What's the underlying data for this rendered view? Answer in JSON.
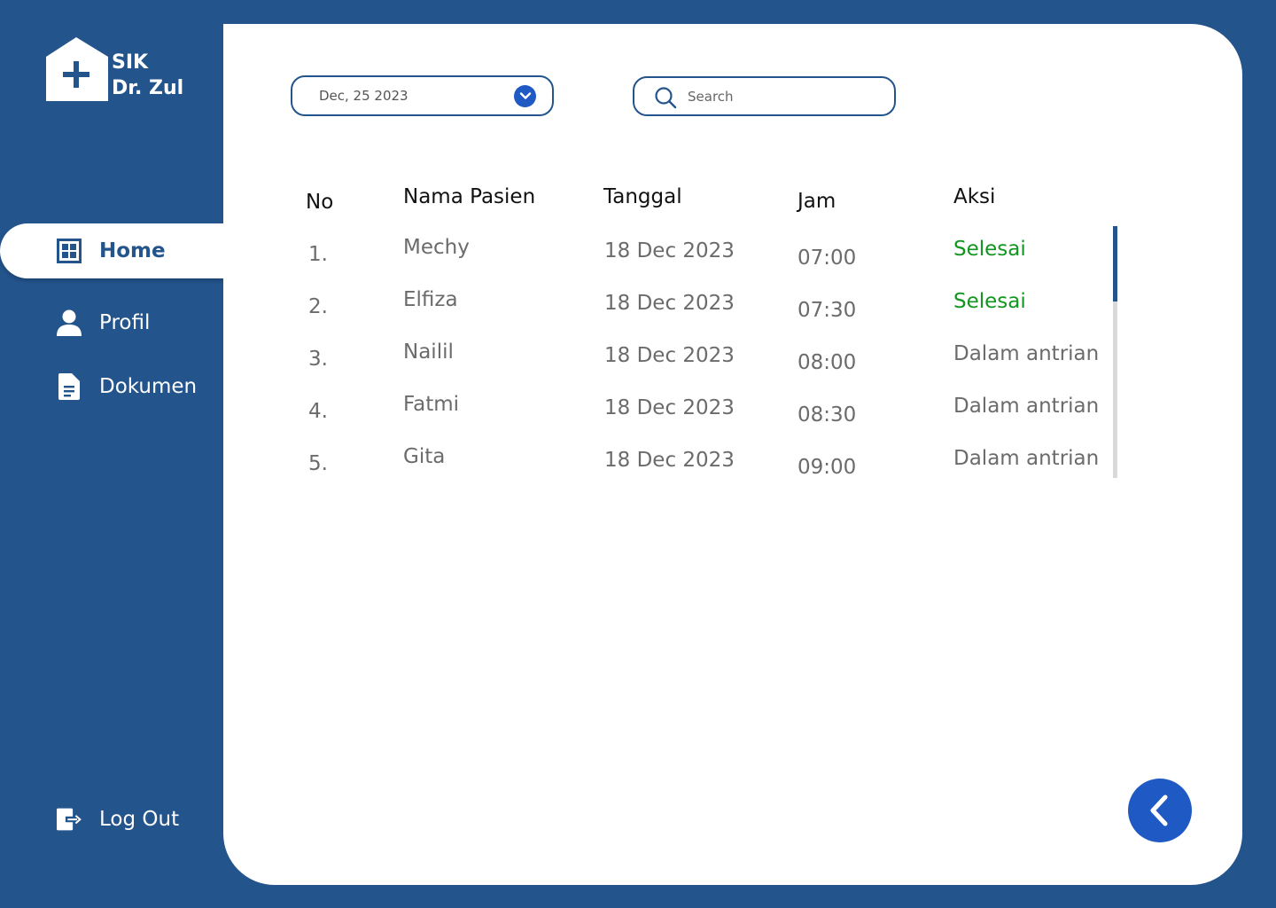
{
  "brand": {
    "line1": "SIK",
    "line2": "Dr. Zul"
  },
  "sidebar": {
    "items": [
      {
        "label": "Home",
        "icon": "grid-icon"
      },
      {
        "label": "Profil",
        "icon": "user-icon"
      },
      {
        "label": "Dokumen",
        "icon": "document-icon"
      }
    ],
    "logout": {
      "label": "Log Out",
      "icon": "logout-icon"
    }
  },
  "filters": {
    "date_value": "Dec, 25 2023",
    "search_placeholder": "Search"
  },
  "table": {
    "headers": {
      "no": "No",
      "name": "Nama Pasien",
      "date": "Tanggal",
      "time": "Jam",
      "action": "Aksi"
    },
    "rows": [
      {
        "no": "1.",
        "name": "Mechy",
        "date": "18 Dec 2023",
        "time": "07:00",
        "action": "Selesai",
        "status": "done"
      },
      {
        "no": "2.",
        "name": "Elfiza",
        "date": "18 Dec 2023",
        "time": "07:30",
        "action": "Selesai",
        "status": "done"
      },
      {
        "no": "3.",
        "name": "Nailil",
        "date": "18 Dec 2023",
        "time": "08:00",
        "action": "Dalam antrian",
        "status": "queue"
      },
      {
        "no": "4.",
        "name": "Fatmi",
        "date": "18 Dec 2023",
        "time": "08:30",
        "action": "Dalam antrian",
        "status": "queue"
      },
      {
        "no": "5.",
        "name": "Gita",
        "date": "18 Dec 2023",
        "time": "09:00",
        "action": "Dalam antrian",
        "status": "queue"
      }
    ]
  },
  "colors": {
    "brand_blue": "#23548C",
    "accent_blue": "#1F59C4",
    "done_green": "#12961F"
  }
}
